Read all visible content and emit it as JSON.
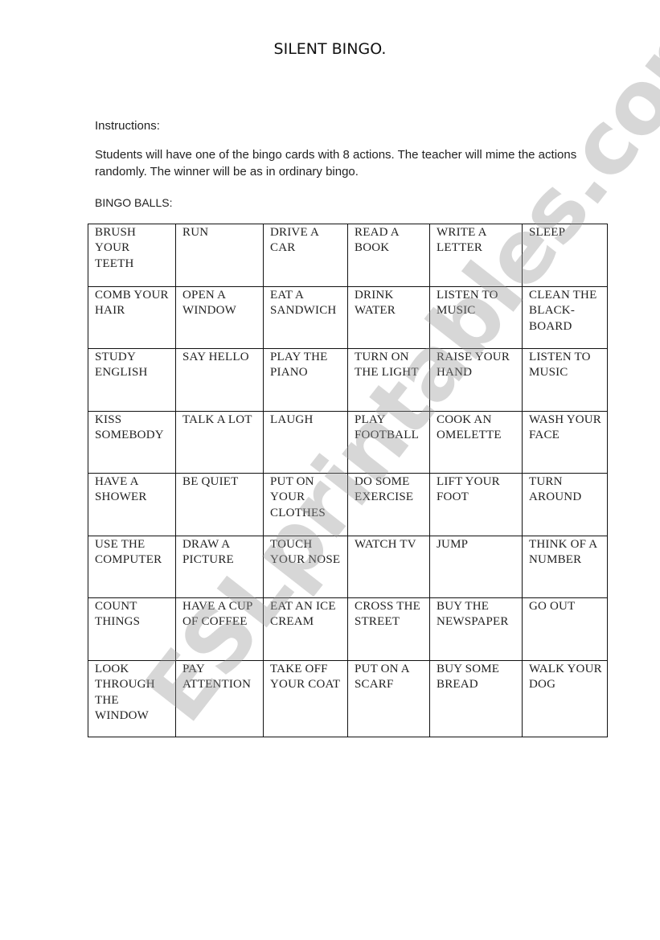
{
  "document": {
    "title": "SILENT BINGO.",
    "instructions_label": "Instructions:",
    "instructions_text": "Students will have one of the bingo cards with 8 actions. The teacher will mime the actions randomly. The winner will be as in ordinary bingo.",
    "bingo_balls_label": "BINGO BALLS:"
  },
  "bingo_balls": {
    "rows": [
      [
        "BRUSH YOUR TEETH",
        "RUN",
        "DRIVE A CAR",
        "READ A BOOK",
        "WRITE A LETTER",
        "SLEEP"
      ],
      [
        "COMB YOUR HAIR",
        "OPEN A WINDOW",
        "EAT A SANDWICH",
        "DRINK WATER",
        "LISTEN TO MUSIC",
        "CLEAN THE BLACK-BOARD"
      ],
      [
        "STUDY ENGLISH",
        "SAY HELLO",
        "PLAY THE PIANO",
        "TURN ON THE LIGHT",
        "RAISE YOUR HAND",
        "LISTEN TO MUSIC"
      ],
      [
        "KISS SOMEBODY",
        "TALK A LOT",
        "LAUGH",
        "PLAY FOOTBALL",
        "COOK AN OMELETTE",
        "WASH YOUR FACE"
      ],
      [
        "HAVE A SHOWER",
        "BE QUIET",
        "PUT ON YOUR CLOTHES",
        "DO SOME EXERCISE",
        "LIFT YOUR FOOT",
        "TURN AROUND"
      ],
      [
        "USE THE COMPUTER",
        "DRAW A PICTURE",
        "TOUCH YOUR NOSE",
        "WATCH TV",
        "JUMP",
        "THINK OF A NUMBER"
      ],
      [
        "COUNT THINGS",
        "HAVE A CUP OF COFFEE",
        "EAT AN ICE CREAM",
        "CROSS THE STREET",
        "BUY THE NEWSPAPER",
        "GO OUT"
      ],
      [
        "LOOK THROUGH THE WINDOW",
        "PAY ATTENTION",
        "TAKE OFF YOUR COAT",
        "PUT ON A SCARF",
        "BUY SOME BREAD",
        "WALK YOUR DOG"
      ]
    ]
  },
  "watermark": {
    "text": "ESLprintables.com"
  }
}
